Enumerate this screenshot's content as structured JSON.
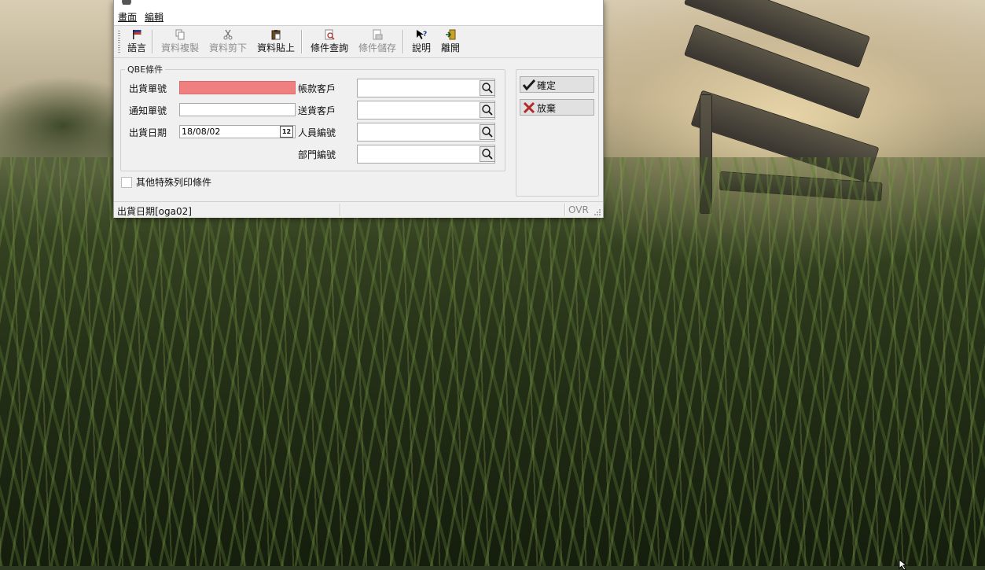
{
  "menu": {
    "items": [
      "畫面",
      "編輯"
    ]
  },
  "toolbar": {
    "buttons": [
      {
        "label": "語言",
        "icon": "flag-icon",
        "enabled": true
      },
      {
        "label": "資料複製",
        "icon": "copy-icon",
        "enabled": false
      },
      {
        "label": "資料剪下",
        "icon": "scissors-icon",
        "enabled": false
      },
      {
        "label": "資料貼上",
        "icon": "clipboard-icon",
        "enabled": true
      },
      {
        "label": "條件查詢",
        "icon": "query-icon",
        "enabled": true
      },
      {
        "label": "條件儲存",
        "icon": "save-query-icon",
        "enabled": false
      },
      {
        "label": "說明",
        "icon": "help-icon",
        "enabled": true
      },
      {
        "label": "離開",
        "icon": "exit-icon",
        "enabled": true
      }
    ]
  },
  "form": {
    "group_title": "QBE條件",
    "fields": {
      "shipment_no": {
        "label": "出貨單號",
        "value": ""
      },
      "notice_no": {
        "label": "通知單號",
        "value": ""
      },
      "ship_date": {
        "label": "出貨日期",
        "value": "18/08/02"
      },
      "account_customer": {
        "label": "帳款客戶",
        "value": ""
      },
      "ship_customer": {
        "label": "送貨客戶",
        "value": ""
      },
      "staff_no": {
        "label": "人員編號",
        "value": ""
      },
      "dept_no": {
        "label": "部門編號",
        "value": ""
      }
    },
    "calendar_button": "12",
    "special_print_label": "其他特殊列印條件",
    "special_print_checked": false
  },
  "actions": {
    "confirm": "確定",
    "cancel": "放棄"
  },
  "status": {
    "field_hint": "出貨日期[oga02]",
    "mode": "OVR"
  },
  "colors": {
    "required_field": "#f08080",
    "confirm_check": "#1a1a1a",
    "cancel_x": "#b02a2a"
  }
}
